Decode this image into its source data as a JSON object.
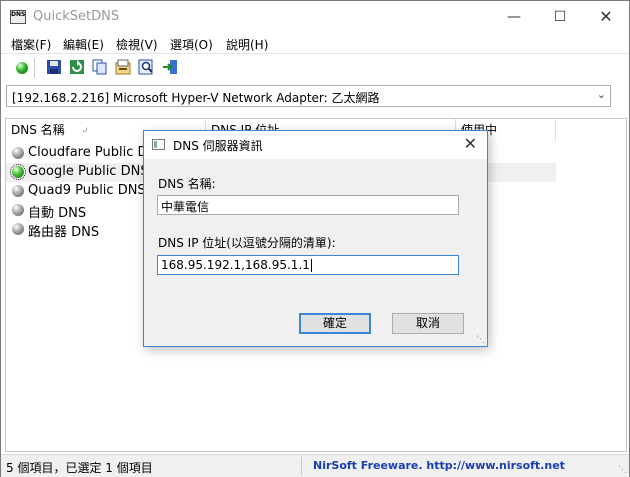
{
  "window": {
    "title": "QuickSetDNS",
    "app_icon_text": "DNS"
  },
  "menu": [
    "檔案(F)",
    "編輯(E)",
    "檢視(V)",
    "選項(O)",
    "說明(H)"
  ],
  "adapter": {
    "value": "[192.168.2.216]  Microsoft Hyper-V Network Adapter: 乙太網路"
  },
  "list": {
    "columns": [
      "DNS 名稱",
      "DNS IP 位址",
      "使用中"
    ],
    "rows": [
      {
        "name": "Cloudfare Public DNS"
      },
      {
        "name": "Google Public DNS S"
      },
      {
        "name": "Quad9 Public DNS S"
      },
      {
        "name": "自動 DNS"
      },
      {
        "name": "路由器 DNS"
      }
    ]
  },
  "status": {
    "left": "5 個項目，已選定 1 個項目",
    "right": "NirSoft Freeware.  http://www.nirsoft.net"
  },
  "dialog": {
    "title": "DNS 伺服器資訊",
    "name_label": "DNS 名稱:",
    "name_value": "中華電信",
    "ip_label": "DNS IP 位址(以逗號分隔的清單):",
    "ip_value": "168.95.192.1,168.95.1.1",
    "ok": "確定",
    "cancel": "取消"
  },
  "colors": {
    "accent": "#3c86d8",
    "link": "#1a3fb0"
  }
}
